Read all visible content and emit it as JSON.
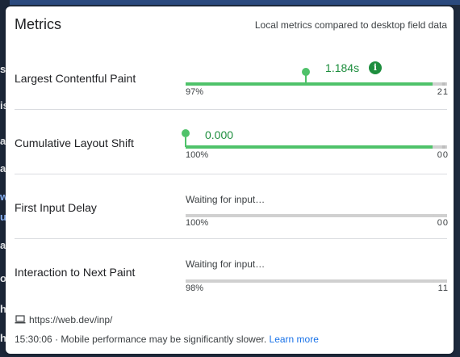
{
  "background": {
    "edge_chars": [
      "s",
      "is",
      "a",
      "a",
      "w",
      "u",
      "a",
      "o",
      "h",
      "h"
    ]
  },
  "metrics_panel": {
    "title": "Metrics",
    "subtitle": "Local metrics compared to desktop field data",
    "metrics": [
      {
        "label": "Largest Contentful Paint",
        "value": "1.184s",
        "status": "good",
        "info_icon": "i",
        "good_pct": "97%",
        "poor_pct": "21",
        "distribution": {
          "good": 0.95,
          "needs_improvement": 0.03,
          "poor": 0.02
        },
        "marker_position": 0.46
      },
      {
        "label": "Cumulative Layout Shift",
        "value": "0.000",
        "status": "good",
        "good_pct": "100%",
        "poor_pct": "00",
        "distribution": {
          "good": 0.95,
          "needs_improvement": 0.03,
          "poor": 0.02
        },
        "marker_position": 0.0
      },
      {
        "label": "First Input Delay",
        "waiting_text": "Waiting for input…",
        "good_pct": "100%",
        "poor_pct": "00",
        "distribution": {
          "good": 0.95,
          "needs_improvement": 0.03,
          "poor": 0.02
        }
      },
      {
        "label": "Interaction to Next Paint",
        "waiting_text": "Waiting for input…",
        "good_pct": "98%",
        "poor_pct": "11",
        "distribution": {
          "good": 0.95,
          "needs_improvement": 0.03,
          "poor": 0.02
        }
      }
    ],
    "footer": {
      "url": "https://web.dev/inp/",
      "url_icon": "laptop-icon",
      "timestamp": "15:30:06",
      "separator": "·",
      "note": "Mobile performance may be significantly slower.",
      "link_text": "Learn more"
    },
    "colors": {
      "good": "#4fc26a",
      "value_text": "#1e8e3e",
      "link": "#1a73e8"
    }
  }
}
